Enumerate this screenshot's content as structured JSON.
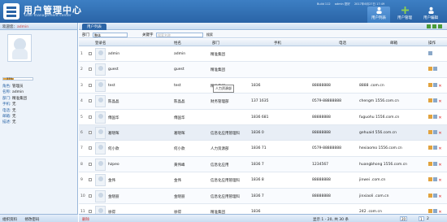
{
  "header": {
    "title": "用户管理中心",
    "subtitle": "User management center",
    "top_info": [
      "Build 112",
      "admin 您好",
      "2017年6月27日 17:49"
    ],
    "nav": [
      {
        "label": "用户列表",
        "icon": "user-list-icon"
      },
      {
        "label": "用户管理",
        "icon": "user-add-icon"
      },
      {
        "label": "用户编辑",
        "icon": "user-edit-icon"
      }
    ]
  },
  "sidebar": {
    "welcome": "欢迎您：",
    "user": "admin",
    "progress_pct": "37%",
    "progress_value": 0.37,
    "info": [
      {
        "k": "角色:",
        "v": "管理员"
      },
      {
        "k": "名称:",
        "v": "admin"
      },
      {
        "k": "部门:",
        "v": "精准集团"
      },
      {
        "k": "手机:",
        "v": "无"
      },
      {
        "k": "电话:",
        "v": "无"
      },
      {
        "k": "邮箱:",
        "v": "无"
      },
      {
        "k": "描述:",
        "v": "无"
      }
    ],
    "footer": [
      "组织资料",
      "修改密码"
    ]
  },
  "main": {
    "tab": "用户列表",
    "toolbar": {
      "dept_label": "部门",
      "dept_value": "整体",
      "kw_label": "关键字",
      "kw_placeholder": "搜索名称",
      "search": "搜索"
    },
    "columns": [
      "登录名",
      "姓名",
      "部门",
      "手机",
      "电话",
      "邮箱",
      "操作"
    ],
    "rows": [
      {
        "idx": "1",
        "login": "admin",
        "name": "admin",
        "dept": "精准集团",
        "mobile": "",
        "phone": "",
        "email": ""
      },
      {
        "idx": "2",
        "login": "guest",
        "name": "guest",
        "dept": "精准集团",
        "mobile": "",
        "phone": "",
        "email": ""
      },
      {
        "idx": "3",
        "login": "test",
        "name": "test",
        "dept": "精准集团",
        "mobile": "1836",
        "phone": "88888888",
        "email": "8888 .com.cn"
      },
      {
        "idx": "4",
        "login": "陈晶晶",
        "name": "陈晶晶",
        "dept": "财务管理部",
        "mobile": "137 1635",
        "phone": "0579-88888888",
        "email": "chengm 1556.com.cn"
      },
      {
        "idx": "5",
        "login": "傅国华",
        "name": "傅国华",
        "dept": "",
        "mobile": "1836 681",
        "phone": "88888888",
        "email": "fuguohu 1556.com.cn"
      },
      {
        "idx": "6",
        "login": "葛晓晖",
        "name": "葛晓晖",
        "dept": "信息化应用管理科",
        "mobile": "1836 0",
        "phone": "88888888",
        "email": "gehuaid 556.com.cn"
      },
      {
        "idx": "7",
        "login": "何小款",
        "name": "何小款",
        "dept": "人力资源部",
        "mobile": "1836 71",
        "phone": "0579-88888888",
        "email": "hexiaomo 1556.com.cn"
      },
      {
        "idx": "8",
        "login": "hzpeo",
        "name": "黄伟峰",
        "dept": "信息化应用",
        "mobile": "1836 7",
        "phone": "1234567",
        "email": "huangbhong 1556.com.cn"
      },
      {
        "idx": "9",
        "login": "金伟",
        "name": "金伟",
        "dept": "信息化应用管理科",
        "mobile": "1836 8",
        "phone": "88888888",
        "email": "jinwei .com.cn"
      },
      {
        "idx": "10",
        "login": "金晓丽",
        "name": "金晓丽",
        "dept": "信息化应用管理科",
        "mobile": "1836 7",
        "phone": "88888888",
        "email": "jinxiaoli .com.cn"
      },
      {
        "idx": "11",
        "login": "徐得",
        "name": "徐得",
        "dept": "精准集团",
        "mobile": "1836",
        "phone": "",
        "email": "242 .com.cn"
      }
    ],
    "tooltip": "人力资源部",
    "pager": {
      "delete": "删除",
      "text": "显示 1 - 20, 共 30 条",
      "page": "1",
      "total": "2"
    }
  }
}
